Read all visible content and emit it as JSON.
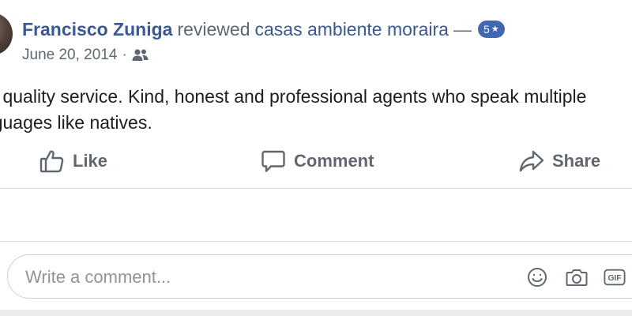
{
  "post": {
    "author": "Francisco Zuniga",
    "verb": "reviewed",
    "page": "casas ambiente moraira",
    "dash": "—",
    "rating": "5",
    "rating_star": "★",
    "date": "June 20, 2014",
    "separator": "·",
    "audience_icon": "friends-icon",
    "body_lines": [
      "Top quality service. Kind, honest and professional agents who speak multiple",
      "languages like natives."
    ]
  },
  "actions": {
    "like": "Like",
    "comment": "Comment",
    "share": "Share"
  },
  "composer": {
    "placeholder": "Write a comment...",
    "icons": [
      "emoji-icon",
      "camera-icon",
      "gif-icon"
    ]
  },
  "colors": {
    "link": "#385898",
    "muted": "#606770",
    "badge": "#4267b2",
    "divider": "#dadde1"
  }
}
